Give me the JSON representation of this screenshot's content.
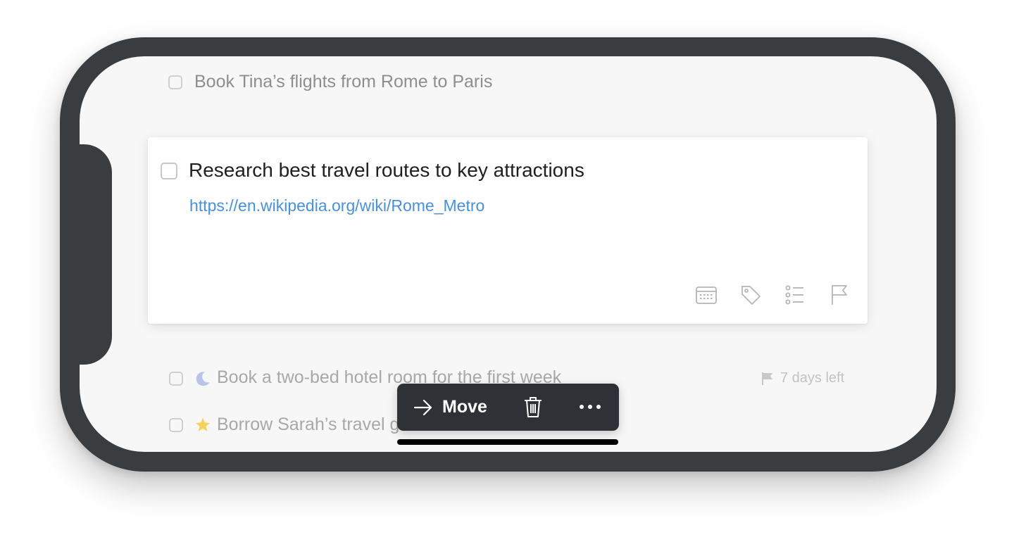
{
  "tasks": {
    "top": {
      "title": "Book Tina’s flights from Rome to Paris"
    },
    "selected": {
      "title": "Research best travel routes to key attractions",
      "link": "https://en.wikipedia.org/wiki/Rome_Metro",
      "actions": [
        "calendar-icon",
        "tag-icon",
        "checklist-icon",
        "flag-icon"
      ]
    },
    "hotel": {
      "title": "Book a two-bed hotel room for the first week",
      "icon": "moon-icon",
      "deadline": "7 days left"
    },
    "guide": {
      "title": "Borrow Sarah’s travel guide",
      "icon": "star-icon"
    }
  },
  "toolbar": {
    "move_label": "Move",
    "move_icon": "arrow-right-icon",
    "delete_icon": "trash-icon",
    "more_icon": "more-icon"
  },
  "colors": {
    "device_frame": "#3a3d40",
    "screen_bg": "#f7f7f7",
    "link": "#4a90d9",
    "toolbar_bg": "#2e3135",
    "moon": "#b8c4e8",
    "star": "#f5d35b"
  }
}
